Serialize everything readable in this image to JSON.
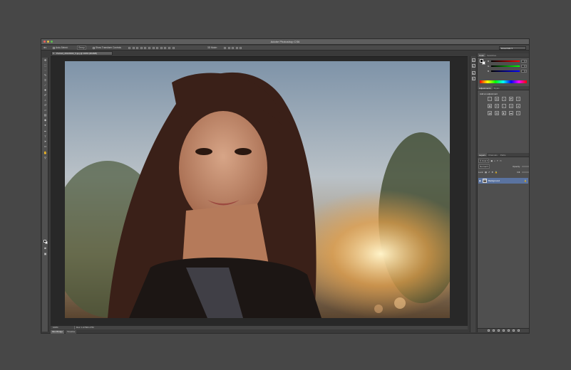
{
  "window": {
    "title": "Adobe Photoshop CS6",
    "traffic_lights": [
      "#ec5f57",
      "#e1c03f",
      "#5ec04f"
    ]
  },
  "options_bar": {
    "tool_icon": "move-tool-icon",
    "auto_select_label": "Auto-Select:",
    "auto_select_value": "Group",
    "show_transform_label": "Show Transform Controls",
    "mode_3d_label": "3D Mode:",
    "workspace": "Essentials"
  },
  "document": {
    "tab_title": "Portrait_20120102_5.jpg @ 100% (RGB/8)",
    "zoom": "100%",
    "doc_size": "Doc: 1.27M/1.27M"
  },
  "bottom_tabs": [
    {
      "label": "Mini Bridge"
    },
    {
      "label": "Timeline"
    }
  ],
  "color_panel": {
    "tabs": [
      "Color",
      "Swatches"
    ],
    "channels": [
      {
        "label": "R",
        "value": "0",
        "gradient_to": "#ff0000"
      },
      {
        "label": "G",
        "value": "0",
        "gradient_to": "#00ff00"
      },
      {
        "label": "B",
        "value": "0",
        "gradient_to": "#0000ff"
      }
    ]
  },
  "adjustments_panel": {
    "tabs": [
      "Adjustments",
      "Styles"
    ],
    "title": "Add an adjustment"
  },
  "layers_panel": {
    "tabs": [
      "Layers",
      "Channels",
      "Paths"
    ],
    "kind": "Kind",
    "blend_mode": "Normal",
    "opacity_label": "Opacity:",
    "lock_label": "Lock:",
    "fill_label": "Fill:",
    "layer_name": "Background"
  },
  "colors": {
    "app_bg": "#3a3a3a",
    "selection_blue": "#5a73a0"
  }
}
